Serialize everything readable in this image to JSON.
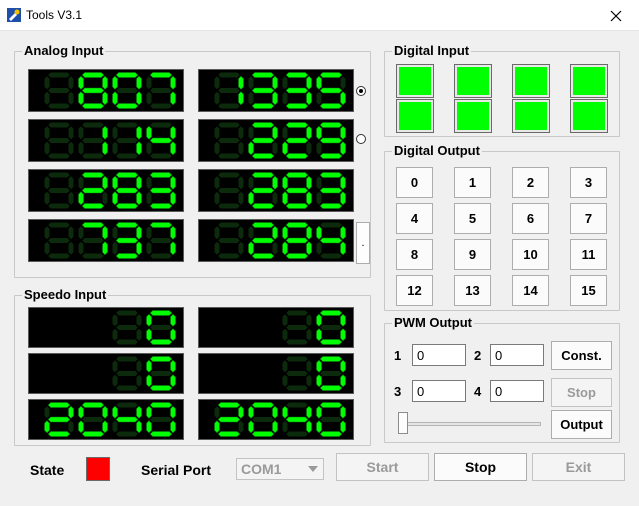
{
  "window": {
    "title": "Tools V3.1"
  },
  "colors": {
    "lcd_on": "#00ff00",
    "lcd_off": "#0c2a0c",
    "led_on": "#00ff00",
    "state": "#ff0000"
  },
  "analog_input": {
    "label": "Analog Input",
    "displays": [
      "807",
      "1335",
      "114",
      "229",
      "283",
      "283",
      "737",
      "284"
    ],
    "radio_selected": 0,
    "small_button_label": "."
  },
  "speedo_input": {
    "label": "Speedo Input",
    "displays": [
      "0",
      "0",
      "0",
      "0",
      "2040",
      "2040"
    ]
  },
  "digital_input": {
    "label": "Digital Input",
    "leds": [
      true,
      true,
      true,
      true,
      true,
      true,
      true,
      true
    ]
  },
  "digital_output": {
    "label": "Digital Output",
    "buttons": [
      "0",
      "1",
      "2",
      "3",
      "4",
      "5",
      "6",
      "7",
      "8",
      "9",
      "10",
      "11",
      "12",
      "13",
      "14",
      "15"
    ]
  },
  "pwm_output": {
    "label": "PWM Output",
    "channels": [
      {
        "label": "1",
        "value": "0"
      },
      {
        "label": "2",
        "value": "0"
      },
      {
        "label": "3",
        "value": "0"
      },
      {
        "label": "4",
        "value": "0"
      }
    ],
    "const_label": "Const.",
    "stop_label": "Stop",
    "output_label": "Output",
    "slider_value": 0
  },
  "status": {
    "state_label": "State",
    "serial_label": "Serial Port",
    "serial_port": "COM1"
  },
  "controls": {
    "start_label": "Start",
    "stop_label": "Stop",
    "exit_label": "Exit"
  }
}
